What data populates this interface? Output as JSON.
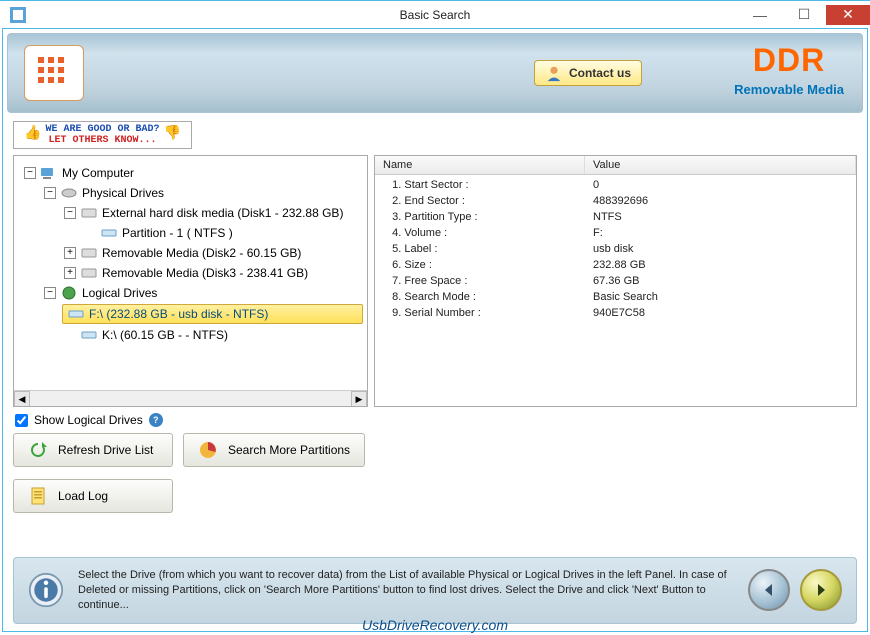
{
  "window": {
    "title": "Basic Search"
  },
  "banner": {
    "contact_label": "Contact us",
    "brand_top": "DDR",
    "brand_sub": "Removable Media"
  },
  "ribbon": {
    "line1": "WE ARE GOOD OR BAD?",
    "line2": "LET OTHERS KNOW..."
  },
  "tree": {
    "root": "My Computer",
    "physical_label": "Physical Drives",
    "disk1": "External hard disk media (Disk1 - 232.88 GB)",
    "disk1_part": "Partition - 1 ( NTFS )",
    "disk2": "Removable Media (Disk2 - 60.15 GB)",
    "disk3": "Removable Media (Disk3 - 238.41 GB)",
    "logical_label": "Logical Drives",
    "vol_f": "F:\\ (232.88 GB - usb disk - NTFS)",
    "vol_k": "K:\\ (60.15 GB -  - NTFS)"
  },
  "controls": {
    "show_logical": "Show Logical Drives",
    "refresh": "Refresh Drive List",
    "search_more": "Search More Partitions",
    "load_log": "Load Log"
  },
  "properties": {
    "headers": {
      "name": "Name",
      "value": "Value"
    },
    "rows": [
      {
        "n": "1. Start Sector :",
        "v": "0"
      },
      {
        "n": "2. End Sector :",
        "v": "488392696"
      },
      {
        "n": "3. Partition Type :",
        "v": "NTFS"
      },
      {
        "n": "4. Volume :",
        "v": "F:"
      },
      {
        "n": "5. Label :",
        "v": "usb disk"
      },
      {
        "n": "6. Size :",
        "v": "232.88 GB"
      },
      {
        "n": "7. Free Space :",
        "v": "67.36 GB"
      },
      {
        "n": "8. Search Mode :",
        "v": "Basic Search"
      },
      {
        "n": "9. Serial Number :",
        "v": "940E7C58"
      }
    ]
  },
  "footer": {
    "text": "Select the Drive (from which you want to recover data) from the List of available Physical or Logical Drives in the left Panel. In case of Deleted or missing Partitions, click on 'Search More Partitions' button to find lost drives. Select the Drive and click 'Next' Button to continue..."
  },
  "url": "UsbDriveRecovery.com"
}
